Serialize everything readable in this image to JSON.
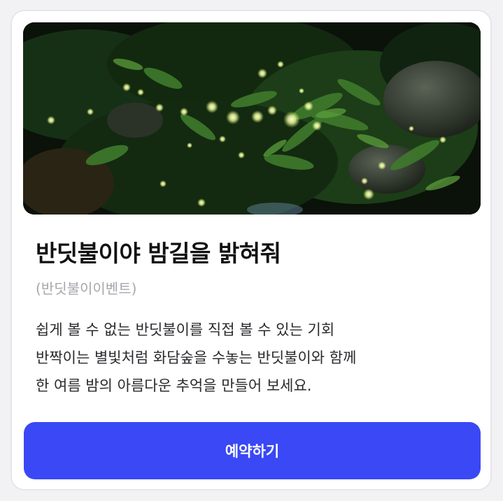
{
  "event": {
    "title": "반딧불이야 밤길을 밝혀줘",
    "subtitle": "(반딧불이이벤트)",
    "description_lines": [
      "쉽게 볼 수 없는 반딧불이를 직접 볼 수 있는 기회",
      "반짝이는 별빛처럼 화담숲을 수놓는 반딧불이와 함께",
      "한 여름 밤의 아름다운 추억을 만들어 보세요."
    ],
    "image_alt": "fireflies-in-forest-photo"
  },
  "actions": {
    "reserve_label": "예약하기"
  },
  "colors": {
    "button": "#3a48f5",
    "title": "#111111",
    "subtitle": "#a6a6ad",
    "body": "#2a2a2e"
  }
}
